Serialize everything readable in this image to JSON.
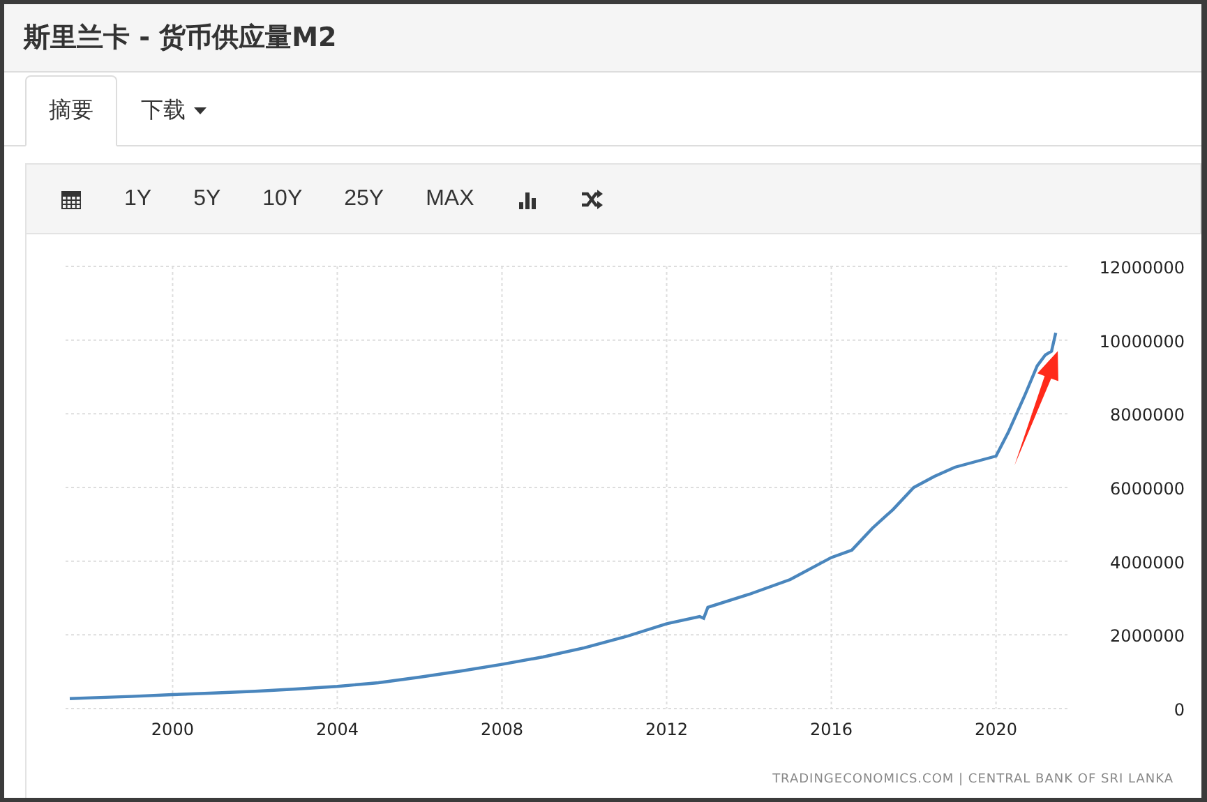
{
  "window": {
    "title": "斯里兰卡 - 货币供应量M2"
  },
  "tabs": [
    {
      "label": "摘要",
      "selected": true,
      "dropdown": false
    },
    {
      "label": "下载",
      "selected": false,
      "dropdown": true
    }
  ],
  "toolbar": [
    {
      "kind": "calendar"
    },
    {
      "kind": "range",
      "label": "1Y"
    },
    {
      "kind": "range",
      "label": "5Y"
    },
    {
      "kind": "range",
      "label": "10Y"
    },
    {
      "kind": "range",
      "label": "25Y"
    },
    {
      "kind": "range",
      "label": "MAX"
    },
    {
      "kind": "bars"
    },
    {
      "kind": "shuffle"
    }
  ],
  "chart": {
    "source": "TRADINGECONOMICS.COM | CENTRAL BANK OF SRI LANKA",
    "chart_data": {
      "type": "line",
      "xlim": [
        1997.4,
        2021.6
      ],
      "ylim": [
        0,
        12000000
      ],
      "x": [
        1997.5,
        1998,
        1999,
        2000,
        2001,
        2002,
        2003,
        2004,
        2005,
        2006,
        2007,
        2008,
        2009,
        2010,
        2011,
        2012,
        2012.8,
        2012.9,
        2013,
        2014,
        2015,
        2016,
        2016.5,
        2017,
        2017.5,
        2018,
        2018.5,
        2019,
        2019.5,
        2020,
        2020.3,
        2020.7,
        2021,
        2021.2,
        2021.35,
        2021.45
      ],
      "series": [
        {
          "color": "#4a86bd",
          "values": [
            270000,
            290000,
            330000,
            380000,
            420000,
            470000,
            530000,
            600000,
            700000,
            850000,
            1020000,
            1200000,
            1400000,
            1650000,
            1950000,
            2300000,
            2500000,
            2450000,
            2750000,
            3100000,
            3500000,
            4100000,
            4300000,
            4900000,
            5400000,
            6000000,
            6300000,
            6550000,
            6700000,
            6850000,
            7500000,
            8500000,
            9300000,
            9600000,
            9700000,
            10200000
          ]
        }
      ],
      "xticks": [
        2000,
        2004,
        2008,
        2012,
        2016,
        2020
      ],
      "yticks": [
        0,
        2000000,
        4000000,
        6000000,
        8000000,
        10000000,
        12000000
      ],
      "grid": true
    },
    "highlight_arrow": {
      "color": "#ff2a1a"
    }
  }
}
